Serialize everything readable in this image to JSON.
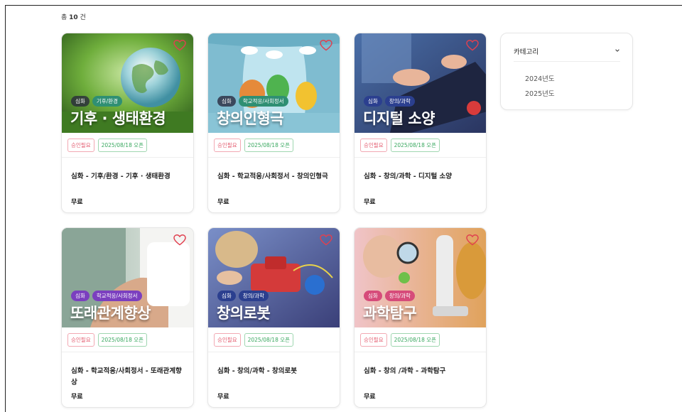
{
  "result_count": {
    "prefix": "총 ",
    "number": "10",
    "suffix": " 건"
  },
  "sidebar": {
    "header": "카테고리",
    "items": [
      "2024년도",
      "2025년도"
    ]
  },
  "cards": [
    {
      "tags": [
        "심화",
        "기후/환경"
      ],
      "overlay_title": "기후 · 생태환경",
      "badge_approval": "승인필요",
      "badge_open": "2025/08/18 오픈",
      "name": "심화 - 기후/환경 - 기후 · 생태환경",
      "price": "무료"
    },
    {
      "tags": [
        "심화",
        "학교적응/사회정서"
      ],
      "overlay_title": "창의인형극",
      "badge_approval": "승인필요",
      "badge_open": "2025/08/18 오픈",
      "name": "심화 - 학교적응/사회정서 - 창의인형극",
      "price": "무료"
    },
    {
      "tags": [
        "심화",
        "창의/과학"
      ],
      "overlay_title": "디지털 소양",
      "badge_approval": "승인필요",
      "badge_open": "2025/08/18 오픈",
      "name": "심화 - 창의/과학 - 디지털 소양",
      "price": "무료"
    },
    {
      "tags": [
        "심화",
        "학교적응/사회정서"
      ],
      "overlay_title": "또래관계향상",
      "badge_approval": "승인필요",
      "badge_open": "2025/08/18 오픈",
      "name": "심화 - 학교적응/사회정서 - 또래관계향상",
      "price": "무료"
    },
    {
      "tags": [
        "심화",
        "창의/과학"
      ],
      "overlay_title": "창의로봇",
      "badge_approval": "승인필요",
      "badge_open": "2025/08/18 오픈",
      "name": "심화 - 창의/과학 - 창의로봇",
      "price": "무료"
    },
    {
      "tags": [
        "심화",
        "창의/과학"
      ],
      "overlay_title": "과학탐구",
      "badge_approval": "승인필요",
      "badge_open": "2025/08/18 오픈",
      "name": "심화 - 창의 /과학 - 과학탐구",
      "price": "무료"
    }
  ],
  "icons": {
    "favorite": "heart-outline-icon",
    "dropdown": "chevron-down-icon"
  },
  "colors": {
    "approval_badge": "#e35a6e",
    "open_badge": "#3aa860",
    "heart": "#e0404f"
  }
}
